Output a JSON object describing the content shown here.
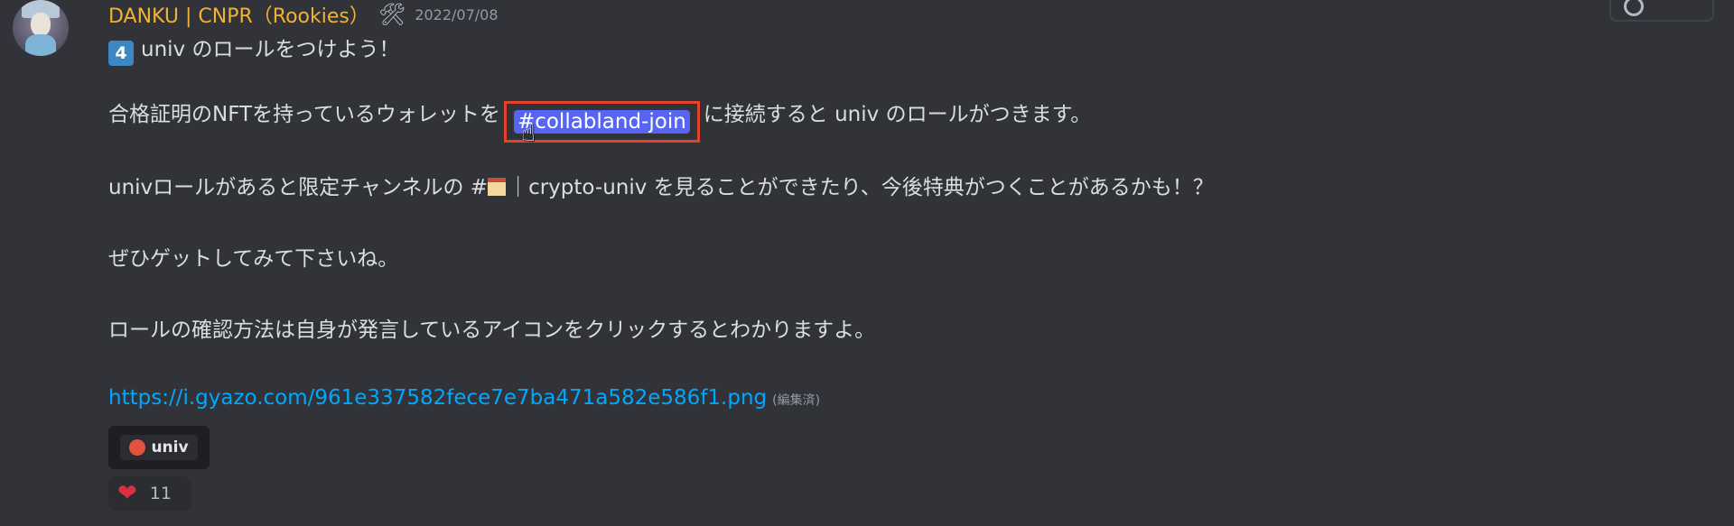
{
  "message": {
    "username": "DANKU | CNPR（Rookies）",
    "role_icon": "hammer-and-wrench-icon",
    "timestamp": "2022/07/08",
    "line1": {
      "badge": "4",
      "text": "univ のロールをつけよう！"
    },
    "line2": {
      "before": "合格証明のNFTを持っているウォレットを",
      "mention": "#collabland-join",
      "after": "に接続すると univ のロールがつきます。"
    },
    "line3": {
      "before": "univロールがあると限定チャンネルの #",
      "channel": "｜crypto-univ",
      "after": " を見ることができたり、今後特典がつくことがあるかも！？"
    },
    "line4": "ぜひゲットしてみて下さいね。",
    "line5": "ロールの確認方法は自身が発言しているアイコンをクリックするとわかりますよ。",
    "link": "https://i.gyazo.com/961e337582fece7e7ba471a582e586f1.png",
    "edited": "(編集済)",
    "role_chip": "univ",
    "reaction": {
      "emoji": "heart-icon",
      "count": "11"
    }
  },
  "colors": {
    "background": "#313338",
    "username": "#f0b232",
    "mention_bg": "#5865f2",
    "highlight_box": "#e2432a",
    "link": "#00a8fc",
    "heart": "#dd2e44",
    "role_dot": "#e4533f"
  }
}
